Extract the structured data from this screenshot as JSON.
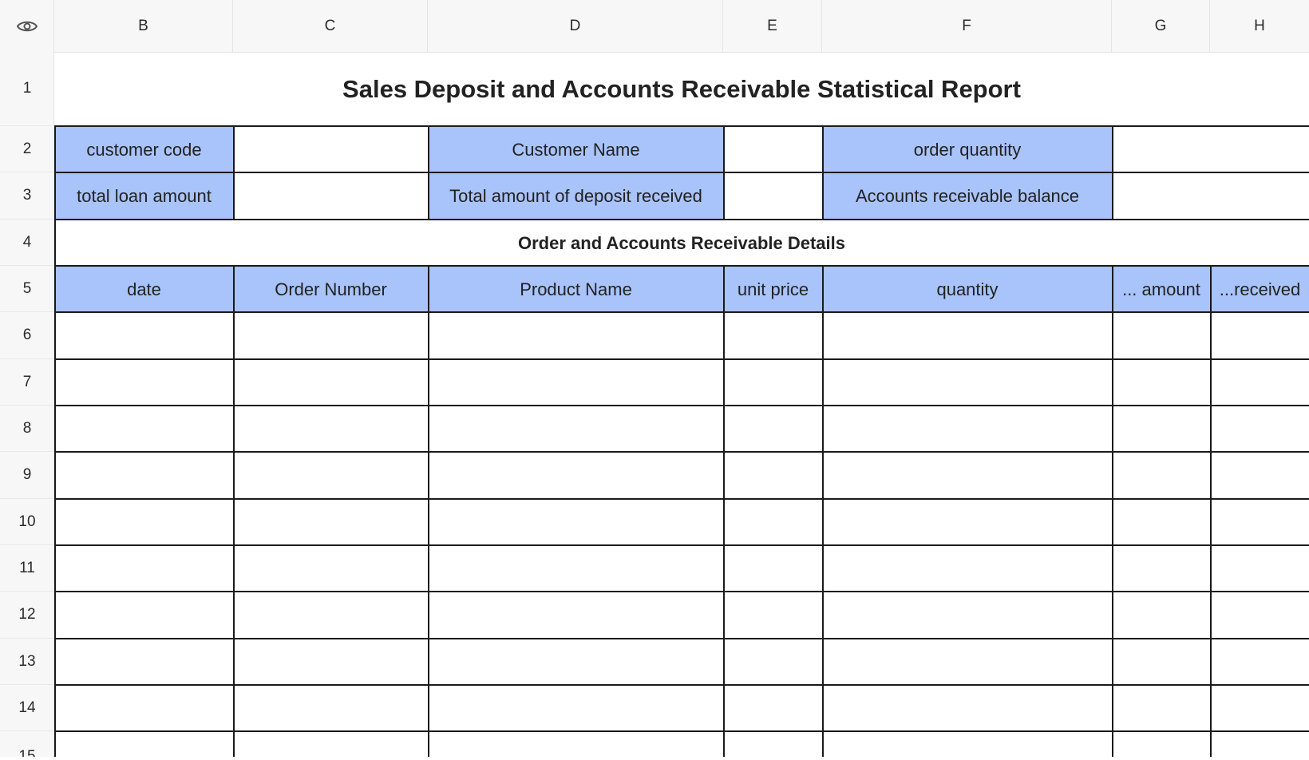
{
  "columns": [
    "B",
    "C",
    "D",
    "E",
    "F",
    "G",
    "H"
  ],
  "rows": [
    "1",
    "2",
    "3",
    "4",
    "5",
    "6",
    "7",
    "8",
    "9",
    "10",
    "11",
    "12",
    "13",
    "14",
    "15"
  ],
  "report": {
    "title": "Sales Deposit and Accounts Receivable Statistical Report",
    "details_title": "Order and Accounts Receivable Details"
  },
  "summary": {
    "customer_code_label": "customer code",
    "customer_name_label": "Customer Name",
    "order_quantity_label": "order quantity",
    "total_loan_amount_label": "total loan amount",
    "total_deposit_label": "Total amount of deposit received",
    "ar_balance_label": "Accounts receivable balance"
  },
  "table_headers": [
    "date",
    "Order Number",
    "Product Name",
    "unit price",
    "quantity",
    "... amount",
    "...received"
  ],
  "colors": {
    "label_fill": "#a9c3fb",
    "grid_line": "#1a1a1a",
    "header_bg": "#f7f7f7"
  },
  "icons": {
    "corner": "eye-icon"
  }
}
